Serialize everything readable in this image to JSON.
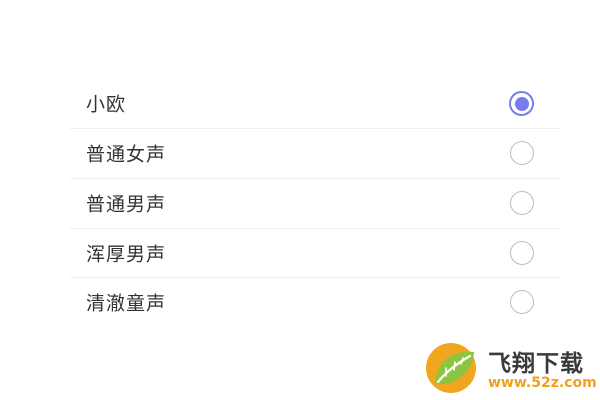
{
  "voice_options": [
    {
      "label": "小欧",
      "selected": true
    },
    {
      "label": "普通女声",
      "selected": false
    },
    {
      "label": "普通男声",
      "selected": false
    },
    {
      "label": "浑厚男声",
      "selected": false
    },
    {
      "label": "清澈童声",
      "selected": false
    }
  ],
  "colors": {
    "accent": "#7b7bf0",
    "text": "#333333",
    "radio_border": "#bdbdbd",
    "divider": "#eeeeee"
  },
  "watermark": {
    "brand": "飞翔下载",
    "url": "www.52z.com"
  }
}
